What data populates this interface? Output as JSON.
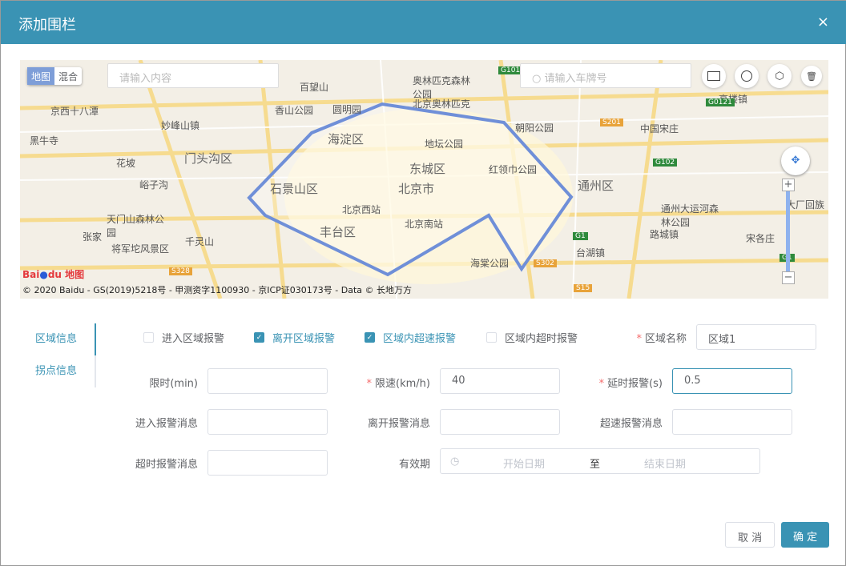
{
  "dialog": {
    "title": "添加围栏",
    "close": "×"
  },
  "map": {
    "type_map": "地图",
    "type_mixed": "混合",
    "search_placeholder": "请输入内容",
    "plate_placeholder": "请输入车牌号",
    "copyright": "© 2020 Baidu - GS(2019)5218号 - 甲测资字1100930 - 京ICP证030173号 - Data © 长地万方",
    "logo": "Bai地图",
    "labels": [
      "北京市",
      "海淀区",
      "东城区",
      "石景山区",
      "丰台区",
      "门头沟区",
      "通州区",
      "北京西站",
      "北京南站",
      "百望山",
      "香山公园",
      "圆明园",
      "奥林匹克森林公园",
      "北京奥林匹克",
      "地坛公园",
      "红领巾公园",
      "朝阳公园",
      "京西十八潭",
      "妙峰山镇",
      "黑牛寺",
      "峪子沟",
      "花坡",
      "天门山森林公园",
      "张家",
      "将军坨风景区",
      "千灵山",
      "海棠公园",
      "台湖镇",
      "中国宋庄",
      "高楼镇",
      "通州大运河森林公园",
      "路城镇",
      "宋各庄",
      "大厂回族"
    ],
    "road_labels": [
      "G101",
      "G0121",
      "S201",
      "G102",
      "G1",
      "G1",
      "S302",
      "S15",
      "S328"
    ]
  },
  "tabs": [
    "区域信息",
    "拐点信息"
  ],
  "checks": [
    {
      "label": "进入区域报警",
      "checked": false
    },
    {
      "label": "离开区域报警",
      "checked": true
    },
    {
      "label": "区域内超速报警",
      "checked": true
    },
    {
      "label": "区域内超时报警",
      "checked": false
    }
  ],
  "form": {
    "area_name_label": "区域名称",
    "area_name": "区域1",
    "time_limit_label": "限时(min)",
    "time_limit": "",
    "speed_label": "限速(km/h)",
    "speed": "40",
    "delay_label": "延时报警(s)",
    "delay": "0.5",
    "enter_msg_label": "进入报警消息",
    "leave_msg_label": "离开报警消息",
    "speed_msg_label": "超速报警消息",
    "timeout_msg_label": "超时报警消息",
    "valid_label": "有效期",
    "start_placeholder": "开始日期",
    "to": "至",
    "end_placeholder": "结束日期",
    "required": "*"
  },
  "buttons": {
    "cancel": "取 消",
    "ok": "确 定"
  },
  "colors": {
    "accent": "#3a93b4",
    "fence": "#6f8fd8"
  }
}
